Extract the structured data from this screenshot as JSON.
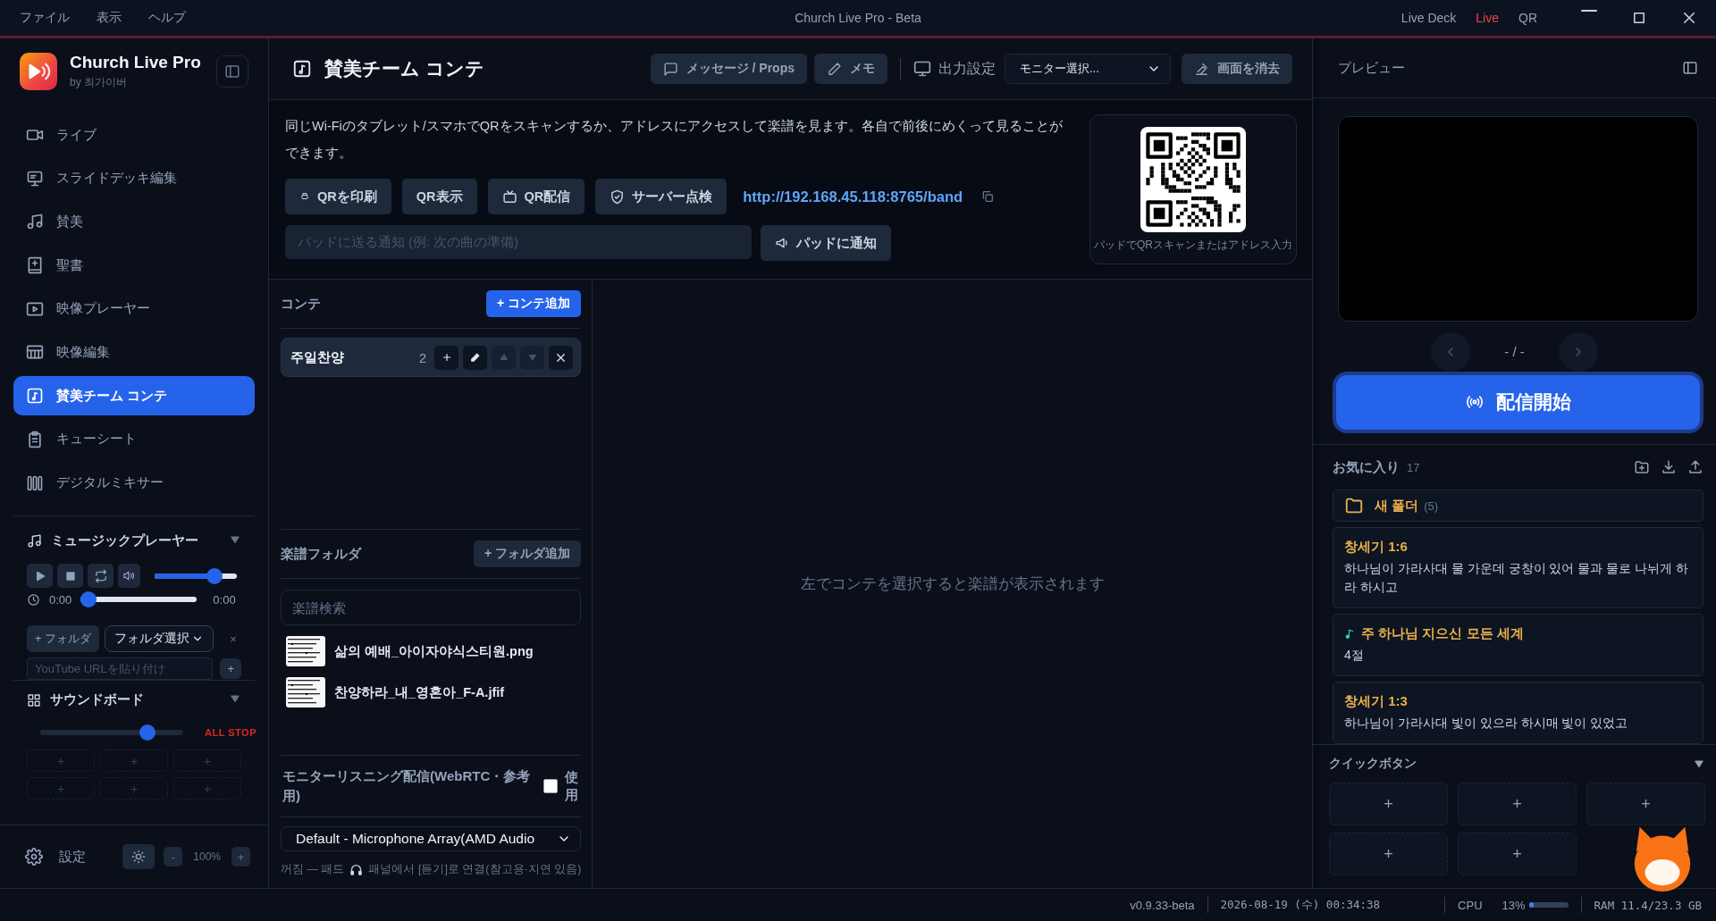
{
  "menu": [
    {
      "label": "ファイル"
    },
    {
      "label": "表示"
    },
    {
      "label": "ヘルプ"
    }
  ],
  "window": {
    "title": "Church Live Pro - Beta"
  },
  "title_links": [
    {
      "label": "Live Deck",
      "selected": false
    },
    {
      "label": "Live",
      "selected": true
    },
    {
      "label": "QR",
      "selected": false
    }
  ],
  "app": {
    "name": "Church Live Pro",
    "byline": "by 최가이버"
  },
  "nav": [
    {
      "label": "ライブ",
      "selected": false
    },
    {
      "label": "スライドデッキ編集",
      "selected": false
    },
    {
      "label": "賛美",
      "selected": false
    },
    {
      "label": "聖書",
      "selected": false
    },
    {
      "label": "映像プレーヤー",
      "selected": false
    },
    {
      "label": "映像編集",
      "selected": false
    },
    {
      "label": "賛美チーム コンテ",
      "selected": true
    },
    {
      "label": "キューシート",
      "selected": false
    },
    {
      "label": "デジタルミキサー",
      "selected": false
    }
  ],
  "music_player": {
    "title": "ミュージックプレーヤー",
    "volume": {
      "level": 0.78
    },
    "seek": {
      "level": 0.0
    },
    "time_current": "0:00",
    "time_total": "0:00",
    "add_folder": "+ フォルダ",
    "folder_select": "フォルダ選択",
    "clear": "×",
    "youtube": {
      "placeholder": "YouTube URLを貼り付け"
    },
    "add": "+"
  },
  "soundboard": {
    "title": "サウンドボード",
    "volume": {
      "level": 0.78
    },
    "all_stop": "ALL STOP",
    "slots": [
      "+",
      "+",
      "+",
      "+",
      "+",
      "+"
    ]
  },
  "settings": {
    "label": "設定",
    "zoom_minus": "-",
    "zoom": "100%",
    "zoom_plus": "+"
  },
  "page": {
    "title": "賛美チーム コンテ",
    "toolbar": [
      {
        "label": "メッセージ / Props"
      },
      {
        "label": "メモ"
      }
    ],
    "output_label": "出力設定",
    "monitor": "モニター選択...",
    "clear_screen": "画面を消去"
  },
  "band": {
    "description": "同じWi-Fiのタブレット/スマホでQRをスキャンするか、アドレスにアクセスして楽譜を見ます。各自で前後にめくって見ることができます。",
    "buttons": [
      {
        "label": "QRを印刷"
      },
      {
        "label": "QR表示"
      },
      {
        "label": "QR配信"
      },
      {
        "label": "サーバー点検"
      }
    ],
    "url": "http://192.168.45.118:8765/band",
    "notify": {
      "placeholder": "パッドに送る通知 (例: 次の曲の準備)"
    },
    "notify_button": "パッドに通知",
    "qr_caption": "パッドでQRスキャンまたはアドレス入力"
  },
  "conte": {
    "title": "コンテ",
    "add": "+ コンテ追加",
    "items": [
      {
        "name": "주일찬양",
        "count": "2",
        "selected": true,
        "move_up_disabled": true,
        "move_down_disabled": true
      }
    ]
  },
  "score_folder": {
    "title": "楽譜フォルダ",
    "add": "+ フォルダ追加",
    "search": {
      "placeholder": "楽譜検索"
    },
    "files": [
      {
        "name": "삶의 예배_아이자야식스티원.png"
      },
      {
        "name": "찬양하라_내_영혼아_F-A.jfif"
      }
    ]
  },
  "monitor_listening": {
    "label": "モニターリスニング配信(WebRTC・参考用)",
    "checkbox": {
      "label": "使用",
      "checked": false
    },
    "device": "Default - Microphone Array(AMD Audio",
    "hint_before": "꺼짐 — 패드",
    "hint_after": "패널에서 [듣기]로 연결(참고용·지연 있음)"
  },
  "viewer": {
    "empty_message": "左でコンテを選択すると楽譜が表示されます"
  },
  "preview": {
    "title": "プレビュー",
    "page": "- / -",
    "start": "配信開始"
  },
  "favorites": {
    "title": "お気に入り",
    "count": "17",
    "folder": {
      "name": "새 폴더",
      "count": "(5)"
    },
    "items": [
      {
        "kind": "verse",
        "title": "창세기 1:6",
        "text": "하나님이 가라사대 물 가운데 궁창이 있어 물과 물로 나뉘게 하라 하시고"
      },
      {
        "kind": "song",
        "title": "주 하나님 지으신 모든 세계",
        "text": "4절"
      },
      {
        "kind": "verse",
        "title": "창세기 1:3",
        "text": "하나님이 가라사대 빛이 있으라 하시매 빛이 있었고"
      }
    ]
  },
  "quick_buttons": {
    "title": "クイックボタン",
    "slots": [
      "+",
      "+",
      "+",
      "+",
      "+"
    ]
  },
  "status_bar": {
    "version": "v0.9.33-beta",
    "datetime": "2026-08-19 (수) 00:34:38",
    "cpu_label": "CPU",
    "cpu_value": "13%",
    "cpu": {
      "level": 0.13
    },
    "ram": "RAM 11.4/23.3 GB"
  }
}
